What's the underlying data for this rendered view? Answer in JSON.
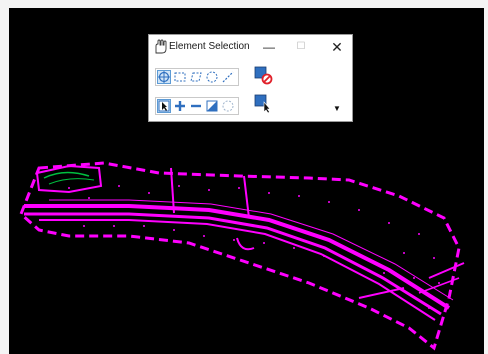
{
  "dialog": {
    "title": "Element Selection",
    "title_icon": "selection-hand-icon",
    "window_buttons": {
      "minimize": "—",
      "maximize": "☐",
      "close": "✕"
    }
  },
  "toolbar_method": {
    "items": [
      {
        "name": "individual-method-icon",
        "active": true
      },
      {
        "name": "block-method-icon",
        "active": false
      },
      {
        "name": "shape-method-icon",
        "active": false
      },
      {
        "name": "circle-method-icon",
        "active": false
      },
      {
        "name": "line-method-icon",
        "active": false
      }
    ],
    "clear_selection_icon": "clear-selection-icon"
  },
  "toolbar_mode": {
    "items": [
      {
        "name": "new-mode-icon",
        "active": true
      },
      {
        "name": "add-mode-icon",
        "active": false
      },
      {
        "name": "subtract-mode-icon",
        "active": false
      },
      {
        "name": "invert-mode-icon",
        "active": false
      },
      {
        "name": "select-all-mode-icon",
        "active": false
      }
    ],
    "select-all_icon": "select-all-elements-icon",
    "dropdown_icon": "dropdown-arrow-icon"
  },
  "colors": {
    "canvas_background": "#000000",
    "selection_highlight": "#ff00ff",
    "accent_blue": "#2f6fbf",
    "no_red": "#e0202a"
  }
}
